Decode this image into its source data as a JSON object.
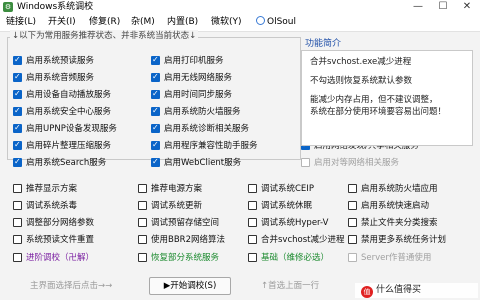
{
  "window": {
    "title": "Windows系统调校",
    "minimize_glyph": "—",
    "maximize_glyph": "☐",
    "close_glyph": "✕"
  },
  "menu": [
    "链接(L)",
    "开关(I)",
    "修复(R)",
    "杂(M)",
    "内置(B)",
    "微软(Y)",
    "OlSoul"
  ],
  "group": {
    "title": "↓以下为常用服务推荐状态、并非系统当前状态↓"
  },
  "recommended_services": [
    {
      "label": "启用系统预读服务",
      "checked": true
    },
    {
      "label": "启用打印机服务",
      "checked": true
    },
    {
      "label": "启用系统音频服务",
      "checked": true
    },
    {
      "label": "启用无线网络服务",
      "checked": true
    },
    {
      "label": "启用设备自动播放服务",
      "checked": true
    },
    {
      "label": "启用时间同步服务",
      "checked": true
    },
    {
      "label": "启用系统安全中心服务",
      "checked": true
    },
    {
      "label": "启用系统防火墙服务",
      "checked": true
    },
    {
      "label": "启用UPNP设备发现服务",
      "checked": true
    },
    {
      "label": "启用系统诊断相关服务",
      "checked": true
    },
    {
      "label": "启用碎片整理压缩服务",
      "checked": true
    },
    {
      "label": "启用程序兼容性助手服务",
      "checked": true
    },
    {
      "label": "启用网络发现/共享相关服务",
      "checked": true
    },
    {
      "label": "启用系统Search服务",
      "checked": true
    },
    {
      "label": "启用WebClient服务",
      "checked": true
    },
    {
      "label": "启用对等网络相关服务",
      "checked": false,
      "disabled": true
    }
  ],
  "info": {
    "title": "功能简介",
    "lines": [
      "合并svchost.exe减少进程",
      "不勾选则恢复系统默认参数",
      "能减少内存占用，但不建议调整，",
      "系统在部分使用环境要容易出问题！"
    ]
  },
  "options": [
    {
      "label": "推荐显示方案",
      "checked": false
    },
    {
      "label": "推荐电源方案",
      "checked": false
    },
    {
      "label": "调试系统CEIP",
      "checked": false
    },
    {
      "label": "启用系统防火墙应用",
      "checked": false
    },
    {
      "label": "调试系统杀毒",
      "checked": false
    },
    {
      "label": "调试系统更新",
      "checked": false
    },
    {
      "label": "调试系统休眠",
      "checked": false
    },
    {
      "label": "启用系统快速启动",
      "checked": false
    },
    {
      "label": "调整部分网络参数",
      "checked": false
    },
    {
      "label": "调试预留存储空间",
      "checked": false
    },
    {
      "label": "调试系统Hyper-V",
      "checked": false
    },
    {
      "label": "禁止文件夹分类搜索",
      "checked": false
    },
    {
      "label": "系统预读文件重置",
      "checked": false
    },
    {
      "label": "使用BBR2网络算法",
      "checked": false
    },
    {
      "label": "合并svchost减少进程",
      "checked": false
    },
    {
      "label": "禁用更多系统任务计划",
      "checked": false
    }
  ],
  "extra_row": [
    {
      "label": "进阶调校（卍解）",
      "checked": false,
      "color": "#7a1ea1"
    },
    {
      "label": "恢复部分系统服务",
      "checked": false,
      "color": "#1b8a2e"
    },
    {
      "label": "基础（维修必选）",
      "checked": false,
      "color": "#1b8a2e"
    },
    {
      "label": "Server作普通使用",
      "checked": false,
      "color": "#a0a0a0",
      "disabled": true
    }
  ],
  "footer": {
    "left_hint": "主界面选择后点击→→",
    "start_button": "▶开始调校(S)",
    "right_hint": "↑首选上面一行"
  },
  "watermark": {
    "icon_text": "值",
    "text": "什么值得买"
  }
}
